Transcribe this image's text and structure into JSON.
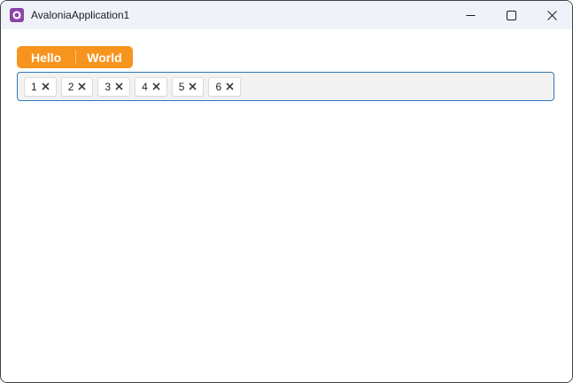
{
  "window": {
    "title": "AvaloniaApplication1",
    "app_icon": "avalonia-logo",
    "controls": [
      {
        "name": "minimize",
        "icon": "minimize-icon"
      },
      {
        "name": "maximize",
        "icon": "maximize-icon"
      },
      {
        "name": "close",
        "icon": "close-icon"
      }
    ]
  },
  "tab_bar": {
    "tabs": [
      {
        "label": "Hello"
      },
      {
        "label": "World"
      }
    ]
  },
  "chip_input": {
    "chips": [
      {
        "value": "1",
        "remove_icon": "close-icon"
      },
      {
        "value": "2",
        "remove_icon": "close-icon"
      },
      {
        "value": "3",
        "remove_icon": "close-icon"
      },
      {
        "value": "4",
        "remove_icon": "close-icon"
      },
      {
        "value": "5",
        "remove_icon": "close-icon"
      },
      {
        "value": "6",
        "remove_icon": "close-icon"
      }
    ]
  },
  "colors": {
    "titlebar_background": "#EFF3F9",
    "window_border": "#424242",
    "accent_orange": "#F7941D",
    "chipbox_border_blue": "#3077B4",
    "chipbox_background": "#F2F2F2",
    "chip_border": "#DBDBDB",
    "logo_purple": "#8B44A8"
  }
}
